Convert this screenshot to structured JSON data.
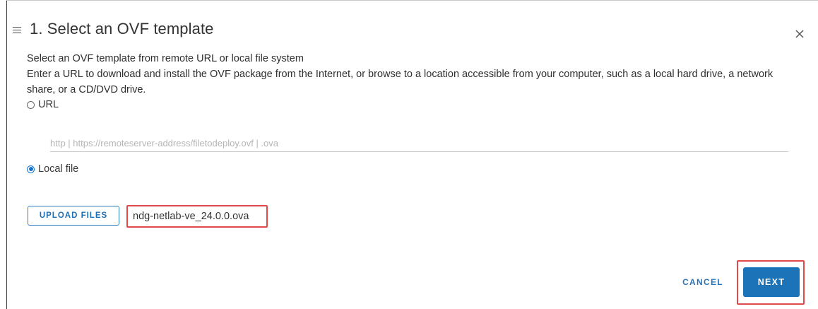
{
  "header": {
    "title": "1. Select an OVF template",
    "menu_icon": "hamburger-icon",
    "close_icon": "close-icon"
  },
  "content": {
    "subtitle": "Select an OVF template from remote URL or local file system",
    "description": "Enter a URL to download and install the OVF package from the Internet, or browse to a location accessible from your computer, such as a local hard drive, a network share, or a CD/DVD drive."
  },
  "source": {
    "url_option_label": "URL",
    "url_option_checked": false,
    "url_placeholder": "http | https://remoteserver-address/filetodeploy.ovf | .ova",
    "url_value": "",
    "local_option_label": "Local file",
    "local_option_checked": true,
    "upload_label": "UPLOAD FILES",
    "selected_file": "ndg-netlab-ve_24.0.0.ova"
  },
  "footer": {
    "cancel_label": "CANCEL",
    "next_label": "NEXT"
  },
  "colors": {
    "accent": "#1d73b8",
    "highlight": "#e04a4a"
  }
}
